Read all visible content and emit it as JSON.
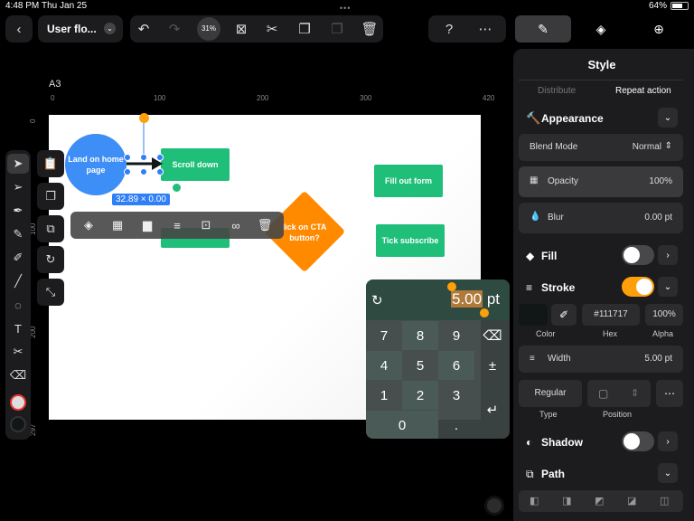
{
  "status": {
    "time": "4:48 PM",
    "date": "Thu Jan 25",
    "battery": "64%"
  },
  "toolbar": {
    "doc_title": "User flo...",
    "zoom": "31%"
  },
  "canvas": {
    "page_label": "A3",
    "ruler_h": [
      "0",
      "100",
      "200",
      "300",
      "420"
    ],
    "ruler_v": [
      "0",
      "100",
      "200",
      "297"
    ],
    "shape_circle": "Land on home page",
    "shape_scroll": "Scroll down",
    "shape_fill": "Fill out form",
    "shape_tick": "Tick subscribe",
    "shape_diamond": "lick on CTA button?",
    "size_badge": "32.89 × 0.00"
  },
  "keypad": {
    "value": "5.00",
    "unit": "pt",
    "keys": [
      "7",
      "8",
      "9",
      "4",
      "5",
      "6",
      "1",
      "2",
      "3",
      "0",
      "."
    ]
  },
  "panel": {
    "title": "Style",
    "seg_left": "Distribute",
    "seg_right": "Repeat action",
    "appearance": "Appearance",
    "blend_label": "Blend Mode",
    "blend_value": "Normal",
    "opacity_label": "Opacity",
    "opacity_value": "100%",
    "blur_label": "Blur",
    "blur_value": "0.00 pt",
    "fill": "Fill",
    "stroke": "Stroke",
    "hex_value": "#111717",
    "alpha_value": "100%",
    "color_caption": "Color",
    "hex_caption": "Hex",
    "alpha_caption": "Alpha",
    "width_label": "Width",
    "width_value": "5.00 pt",
    "type_value": "Regular",
    "type_caption": "Type",
    "position_caption": "Position",
    "shadow": "Shadow",
    "path": "Path"
  },
  "colors": {
    "accent": "#ff9f0a",
    "blue": "#3d8ef6",
    "green": "#1fbf7a",
    "orange": "#ff8a00"
  }
}
